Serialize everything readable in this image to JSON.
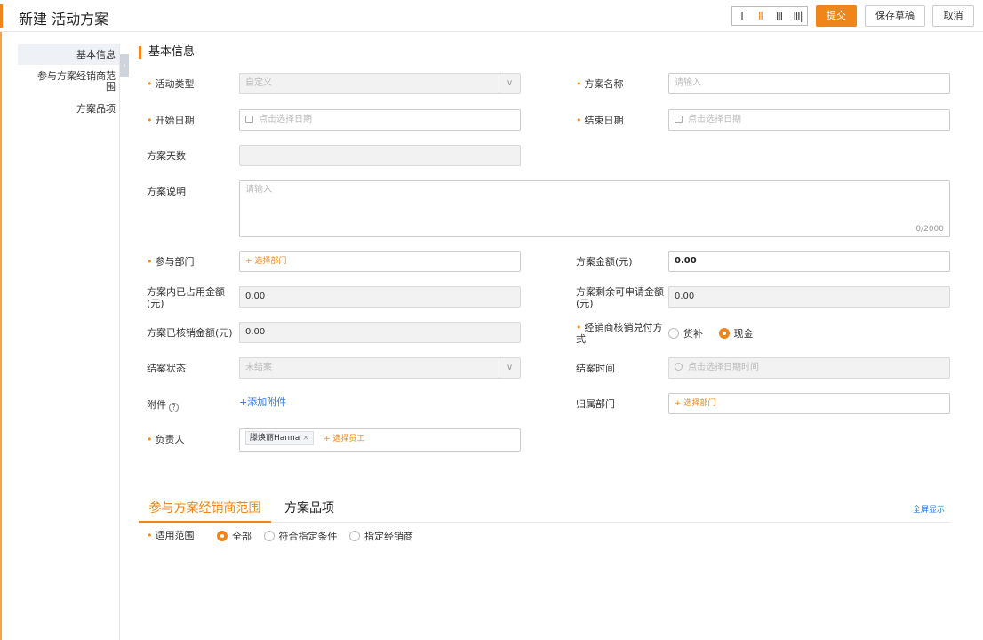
{
  "header": {
    "title": "新建 活动方案",
    "view_options": [
      "Ⅰ",
      "Ⅱ",
      "Ⅲ",
      "Ⅲ|"
    ],
    "submit_label": "提交",
    "save_draft_label": "保存草稿",
    "cancel_label": "取消"
  },
  "sidebar": {
    "items": [
      {
        "label": "基本信息",
        "active": true
      },
      {
        "label": "参与方案经销商范围",
        "active": false
      },
      {
        "label": "方案品项",
        "active": false
      }
    ],
    "collapse_glyph": "‹"
  },
  "section": {
    "title": "基本信息"
  },
  "form": {
    "required_mark": "•",
    "activity_type": {
      "label": "活动类型",
      "value": "自定义",
      "arrow": "∨"
    },
    "plan_name": {
      "label": "方案名称",
      "placeholder": "请输入"
    },
    "start_date": {
      "label": "开始日期",
      "placeholder": "点击选择日期"
    },
    "end_date": {
      "label": "结束日期",
      "placeholder": "点击选择日期"
    },
    "plan_days": {
      "label": "方案天数",
      "value": ""
    },
    "description": {
      "label": "方案说明",
      "placeholder": "请输入",
      "counter": "0/2000"
    },
    "department": {
      "label": "参与部门",
      "add_label": "+ 选择部门"
    },
    "amount": {
      "label": "方案金额(元)",
      "value": "0.00"
    },
    "used_amount": {
      "label": "方案内已占用金额(元)",
      "value": "0.00"
    },
    "remaining_amount": {
      "label": "方案剩余可申请金额(元)",
      "value": "0.00"
    },
    "verified_amount": {
      "label": "方案已核销金额(元)",
      "value": "0.00"
    },
    "payment_method": {
      "label": "经销商核销兑付方式",
      "options": [
        "货补",
        "现金"
      ],
      "selected": "现金"
    },
    "close_status": {
      "label": "结案状态",
      "value": "未结案",
      "arrow": "∨"
    },
    "close_time": {
      "label": "结案时间",
      "placeholder": "点击选择日期时间"
    },
    "attachment": {
      "label": "附件",
      "help": "?",
      "add_label": "+添加附件"
    },
    "owner_department": {
      "label": "归属部门",
      "add_label": "+ 选择部门"
    },
    "owner": {
      "label": "负责人",
      "tag": "滕焕丽Hanna",
      "tag_close": "×",
      "add_label": "+ 选择员工"
    }
  },
  "tabs": {
    "items": [
      {
        "label": "参与方案经销商范围",
        "active": true
      },
      {
        "label": "方案品项",
        "active": false
      }
    ],
    "fullscreen_label": "全屏显示"
  },
  "scope": {
    "label": "适用范围",
    "options": [
      "全部",
      "符合指定条件",
      "指定经销商"
    ],
    "selected": "全部"
  },
  "colors": {
    "accent": "#f08519",
    "link": "#2a7ae2"
  }
}
